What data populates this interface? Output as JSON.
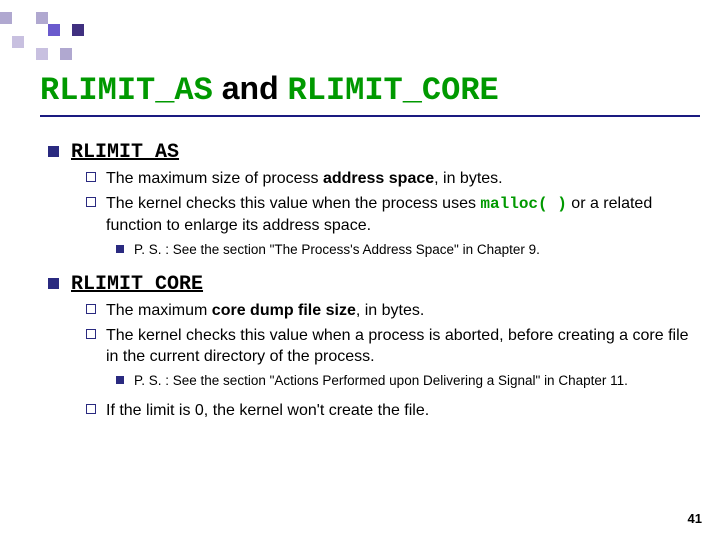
{
  "decoration": {
    "cells": [
      "#b0a8d0",
      "",
      "",
      "#b0a8d0",
      "",
      "",
      "",
      "",
      "",
      "",
      "",
      "#6a5acd",
      "",
      "#403080",
      "",
      "#c8c0e0",
      "",
      "",
      "",
      "",
      "",
      "",
      "",
      "",
      "#c8c0e0",
      "",
      "#b0a8d0",
      ""
    ]
  },
  "title": {
    "code1": "RLIMIT_AS",
    "mid": " and ",
    "code2": "RLIMIT_CORE"
  },
  "section1": {
    "head": "RLIMIT_AS",
    "b1_pre": "The maximum size of process ",
    "b1_bold": "address space",
    "b1_post": ", in bytes.",
    "b2_pre": "The kernel checks this value when the process uses ",
    "b2_code": "malloc( )",
    "b2_post": " or a related function to enlarge its address space.",
    "ps": "P. S. : See the section \"The Process's Address Space\" in Chapter 9."
  },
  "section2": {
    "head": "RLIMIT_CORE",
    "b1_pre": "The maximum ",
    "b1_bold": "core dump file size",
    "b1_post": ", in bytes.",
    "b2": "The kernel checks this value when a process is aborted, before creating a core file in the current directory of the process.",
    "ps": "P. S. : See the section \"Actions Performed upon Delivering a Signal\" in Chapter 11.",
    "b3": "If the limit is 0, the kernel won't create the file."
  },
  "page": "41"
}
